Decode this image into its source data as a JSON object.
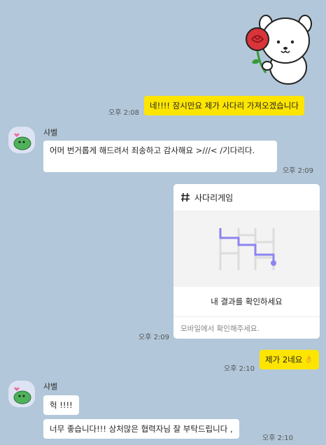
{
  "messages": {
    "m1": {
      "text": "네!!!! 잠시만요 제가 사다리 가져오겠습니다",
      "time": "오후 2:08"
    },
    "m2": {
      "sender": "샤벨",
      "text": "어머 번거롭게 해드려서 죄송하고 감사해요 >///< /기다리다.",
      "time": "오후 2:09"
    },
    "m3": {
      "card_title": "사다리게임",
      "card_action": "내 결과를 확인하세요",
      "card_note": "모바일에서 확인해주세요.",
      "time": "오후 2:09"
    },
    "m4": {
      "text": "제가 2네요",
      "time": "오후 2:10"
    },
    "m5": {
      "sender": "샤벨",
      "text1": "헉 !!!!",
      "text2": "너무 좋습니다!!! 상처많은 협력자님 잘 부탁드립니다 ,",
      "time": "오후 2:10"
    }
  },
  "icons": {
    "hash": "hash-icon",
    "ladder": "ladder-game-icon",
    "sticker": "bear-with-rose-sticker",
    "avatar": "green-creature-avatar",
    "emoji": "hand-emoji"
  },
  "colors": {
    "background": "#b2c7d9",
    "outgoing_bubble": "#fee500",
    "incoming_bubble": "#ffffff",
    "ladder_path": "#8c84f0"
  }
}
